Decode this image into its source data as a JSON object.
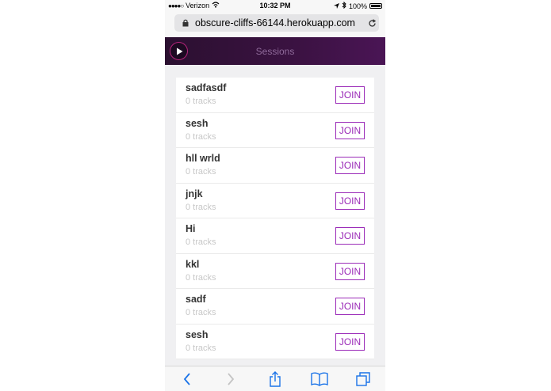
{
  "status_bar": {
    "carrier": "Verizon",
    "time": "10:32 PM",
    "battery": "100%"
  },
  "browser": {
    "url": "obscure-cliffs-66144.herokuapp.com"
  },
  "app": {
    "title": "Sessions",
    "accent_color": "#9b2bb8"
  },
  "sessions": [
    {
      "name": "sadfasdf",
      "tracks": "0 tracks",
      "action": "JOIN"
    },
    {
      "name": "sesh",
      "tracks": "0 tracks",
      "action": "JOIN"
    },
    {
      "name": "hll wrld",
      "tracks": "0 tracks",
      "action": "JOIN"
    },
    {
      "name": "jnjk",
      "tracks": "0 tracks",
      "action": "JOIN"
    },
    {
      "name": "Hi",
      "tracks": "0 tracks",
      "action": "JOIN"
    },
    {
      "name": "kkl",
      "tracks": "0 tracks",
      "action": "JOIN"
    },
    {
      "name": "sadf",
      "tracks": "0 tracks",
      "action": "JOIN"
    },
    {
      "name": "sesh",
      "tracks": "0 tracks",
      "action": "JOIN"
    }
  ],
  "toolbar": {
    "icons": [
      "back-icon",
      "forward-icon",
      "share-icon",
      "bookmarks-icon",
      "tabs-icon"
    ]
  }
}
